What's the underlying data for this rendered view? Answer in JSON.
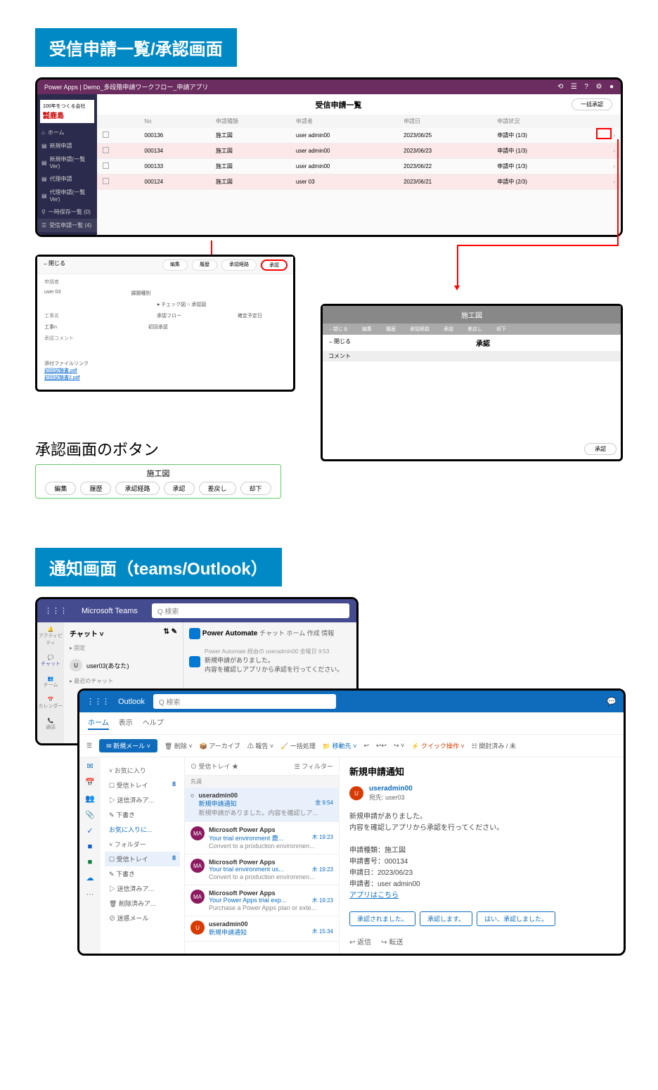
{
  "sec1_title": "受信申請一覧/承認画面",
  "powerapps": {
    "header": "Power Apps | Demo_多段階申請ワークフロー_申請アプリ",
    "logo_top": "100年をつくる会社",
    "logo_main": "鹿島",
    "nav": [
      "ホーム",
      "新規申請",
      "新規申請(一覧Ver)",
      "代理申請",
      "代理申請(一覧Ver)",
      "一時保存一覧 (0)",
      "受信申請一覧 (4)"
    ],
    "list_title": "受信申請一覧",
    "bulk_btn": "一括承認",
    "cols": [
      "No",
      "申請種類",
      "申請者",
      "申請日",
      "申請状況"
    ],
    "rows": [
      {
        "no": "000136",
        "type": "施工図",
        "user": "user admin00",
        "date": "2023/06/25",
        "status": "申請中 (1/3)"
      },
      {
        "no": "000134",
        "type": "施工図",
        "user": "user admin00",
        "date": "2023/06/23",
        "status": "申請中 (1/3)"
      },
      {
        "no": "000133",
        "type": "施工図",
        "user": "user admin00",
        "date": "2023/06/22",
        "status": "申請中 (1/3)"
      },
      {
        "no": "000124",
        "type": "施工図",
        "user": "user 03",
        "date": "2023/06/21",
        "status": "申請中 (2/3)"
      }
    ]
  },
  "detail": {
    "close": "←閉じる",
    "tabs": [
      "編集",
      "履歴",
      "承認経路",
      "承認"
    ],
    "fields": {
      "applicant_l": "申請者",
      "applicant_v": "user 03",
      "type_l": "課題種別",
      "check": "チェック図",
      "approve": "承認図",
      "work_l": "工事名",
      "work_v": "工事n",
      "flow_l": "承認フロー",
      "flow_v": "初回承認",
      "due_l": "確定予定日",
      "comment_l": "承認コメント",
      "attach_l": "添付ファイルリンク",
      "file1": "初回試験書.pdf",
      "file2": "初回試験書2.pdf"
    }
  },
  "approve": {
    "hdr": "施工図",
    "close": "←閉じる",
    "title": "承認",
    "comment": "コメント",
    "btn": "承認"
  },
  "sub_title": "承認画面のボタン",
  "btnpanel": {
    "title": "施工図",
    "btns": [
      "編集",
      "履歴",
      "承認経路",
      "承認",
      "差戻し",
      "却下"
    ]
  },
  "sec2_title": "通知画面（teams/Outlook）",
  "teams": {
    "app": "Microsoft Teams",
    "search": "Q 検索",
    "rail": [
      "アクティビティ",
      "チャット",
      "チーム",
      "カレンダー",
      "通話"
    ],
    "chat": "チャット",
    "pinned": "固定",
    "user": "user03(あなた)",
    "recent": "最近のチャット",
    "pa": "Power Automate",
    "tabs": "チャット ホーム 作成 情報",
    "msg_meta": "Power Automate 経由の useradmin00 金曜日 9:53",
    "msg1": "新規申請がありました。",
    "msg2": "内容を確認しアプリから承認を行ってください。"
  },
  "outlook": {
    "app": "Outlook",
    "search": "Q 検索",
    "tabs": [
      "ホーム",
      "表示",
      "ヘルプ"
    ],
    "toolbar": {
      "new": "新規メール",
      "del": "削除",
      "arch": "アーカイブ",
      "report": "報告",
      "sweep": "一括処理",
      "move": "移動先",
      "quick": "クイック操作",
      "read": "開封済み / 未"
    },
    "fav": "お気に入り",
    "inbox": "受信トレイ",
    "inbox_n": "8",
    "sent": "送信済みア...",
    "draft": "下書き",
    "addfav": "お気に入りに...",
    "folders": "フォルダー",
    "deleted": "削除済みア...",
    "junk": "迷惑メール",
    "list_hdr": "受信トレイ",
    "filter": "フィルター",
    "cat": "先週",
    "msgs": [
      {
        "av": "U",
        "cls": "u",
        "from": "useradmin00",
        "subj": "新規申請通知",
        "prev": "新規申請がありました。内容を確認しア...",
        "time": "金 9:54"
      },
      {
        "av": "MA",
        "cls": "m",
        "from": "Microsoft Power Apps",
        "subj": "Your trial environment 鹿...",
        "prev": "Convert to a production environmen...",
        "time": "木 19:23"
      },
      {
        "av": "MA",
        "cls": "m",
        "from": "Microsoft Power Apps",
        "subj": "Your trial environment us...",
        "prev": "Convert to a production environmen...",
        "time": "木 19:23"
      },
      {
        "av": "MA",
        "cls": "m",
        "from": "Microsoft Power Apps",
        "subj": "Your Power Apps trial exp...",
        "prev": "Purchase a Power Apps plan or exte...",
        "time": "木 19:23"
      },
      {
        "av": "U",
        "cls": "u",
        "from": "useradmin00",
        "subj": "新規申請通知",
        "prev": "",
        "time": "木 15:34"
      }
    ],
    "preview": {
      "title": "新規申請通知",
      "from": "useradmin00",
      "to": "宛先: user03",
      "l1": "新規申請がありました。",
      "l2": "内容を確認しアプリから承認を行ってください。",
      "d1": "申請種類：施工図",
      "d2": "申請書号：000134",
      "d3": "申請日：2023/06/23",
      "d4": "申請者：user admin00",
      "link": "アプリはこちら",
      "btns": [
        "承認されました。",
        "承認します。",
        "はい、承認しました。"
      ],
      "reply": "返信",
      "forward": "転送"
    }
  }
}
